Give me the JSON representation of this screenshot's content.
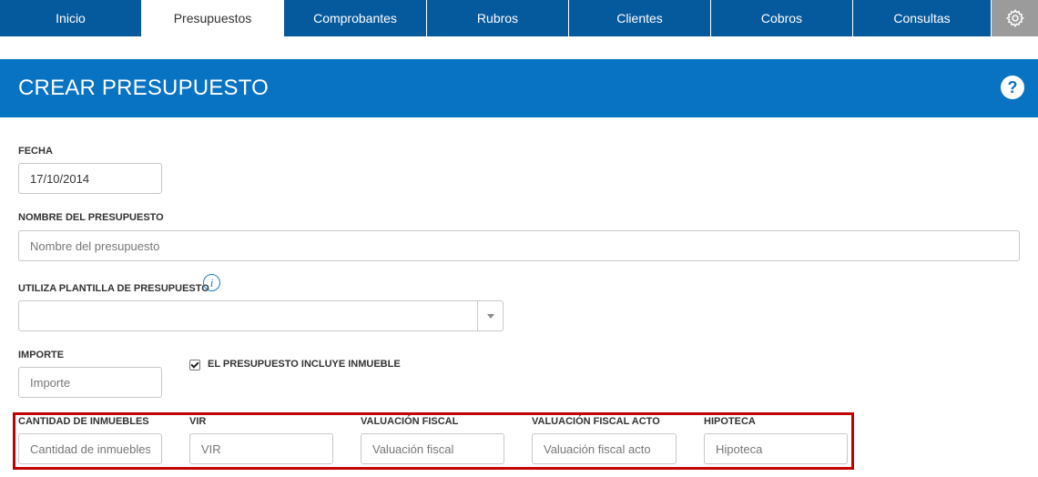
{
  "nav": {
    "tabs": [
      {
        "label": "Inicio"
      },
      {
        "label": "Presupuestos"
      },
      {
        "label": "Comprobantes"
      },
      {
        "label": "Rubros"
      },
      {
        "label": "Clientes"
      },
      {
        "label": "Cobros"
      },
      {
        "label": "Consultas"
      }
    ],
    "active_tab": "Presupuestos",
    "settings_icon": "gear-icon"
  },
  "header": {
    "title": "CREAR PRESUPUESTO",
    "help_icon": "question-circle-icon",
    "help_text": "?"
  },
  "form": {
    "fecha": {
      "label": "FECHA",
      "value": "17/10/2014"
    },
    "nombre": {
      "label": "NOMBRE DEL PRESUPUESTO",
      "placeholder": "Nombre del presupuesto"
    },
    "plantilla": {
      "label": "UTILIZA PLANTILLA DE PRESUPUESTO",
      "value": "",
      "info_icon": "info-icon",
      "info_text": "i"
    },
    "importe": {
      "label": "IMPORTE",
      "placeholder": "Importe"
    },
    "inmueble_checkbox": {
      "label": "EL PRESUPUESTO INCLUYE INMUEBLE",
      "checked": true
    },
    "inmueble_fields": {
      "cantidad": {
        "label": "CANTIDAD DE INMUEBLES",
        "placeholder": "Cantidad de inmuebles"
      },
      "vir": {
        "label": "VIR",
        "placeholder": "VIR"
      },
      "valuacion_fiscal": {
        "label": "VALUACIÓN FISCAL",
        "placeholder": "Valuación fiscal"
      },
      "valuacion_fiscal_acto": {
        "label": "VALUACIÓN FISCAL ACTO",
        "placeholder": "Valuación fiscal acto"
      },
      "hipoteca": {
        "label": "HIPOTECA",
        "placeholder": "Hipoteca"
      }
    }
  },
  "colors": {
    "nav": "#055a9e",
    "banner": "#0873c2",
    "highlight": "#c00000",
    "settings_bg": "#9b9b9b"
  }
}
